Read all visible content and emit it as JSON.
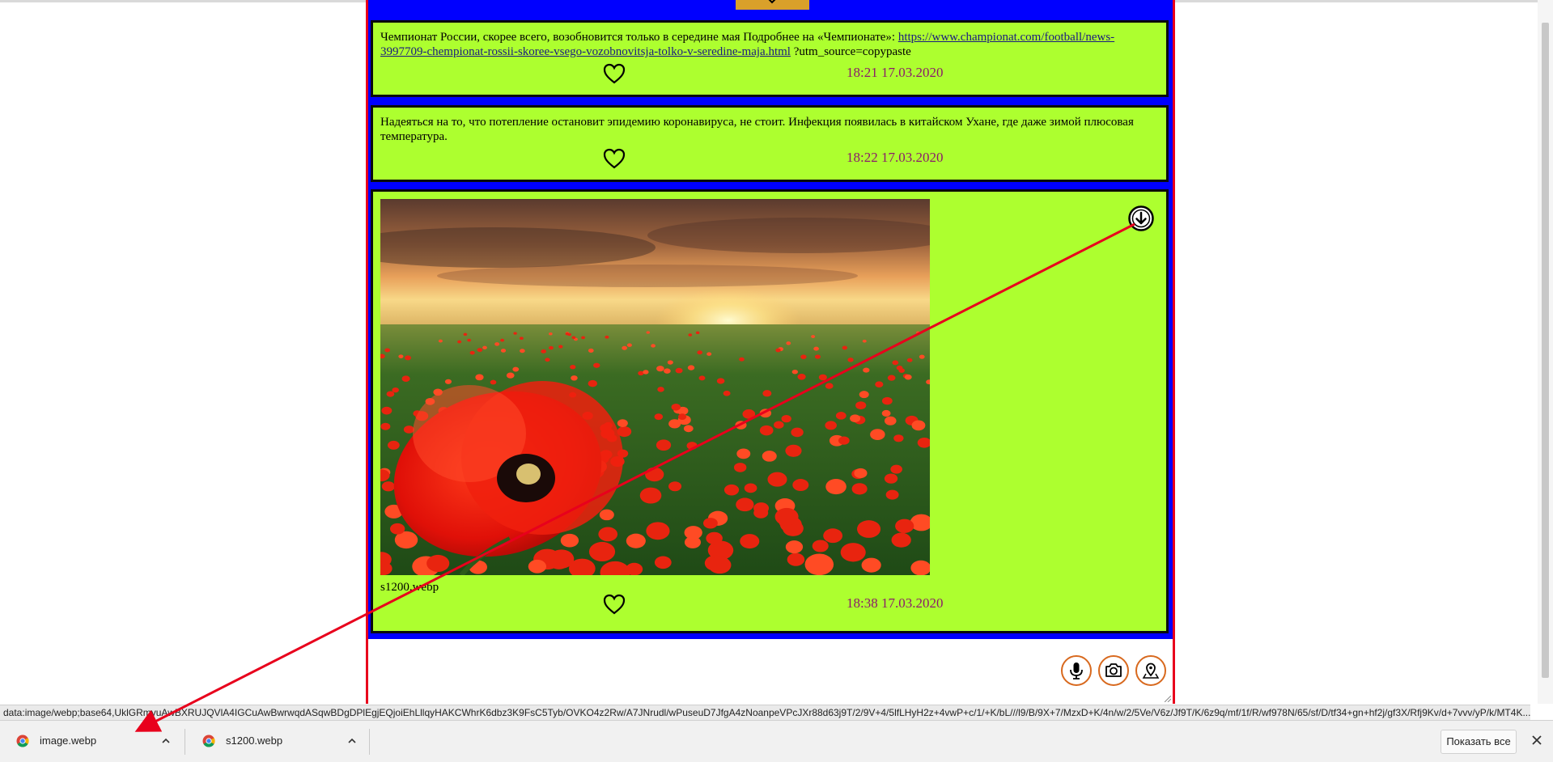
{
  "messages": [
    {
      "text_before": "Чемпионат России, скорее всего, возобновится только в середине мая Подробнее на «Чемпионате»: ",
      "link": "https://www.championat.com/football/news-3997709-chempionat-rossii-skoree-vsego-vozobnovitsja-tolko-v-seredine-maja.html",
      "text_after": " ?utm_source=copypaste",
      "time": "18:21 17.03.2020"
    },
    {
      "text": "Надеяться на то, что потепление остановит эпидемию коронавируса, не стоит. Инфекция появилась в китайском Ухане, где даже зимой плюсовая температура.",
      "time": "18:22 17.03.2020"
    },
    {
      "file_name": "s1200.webp",
      "time": "18:38 17.03.2020"
    }
  ],
  "icons": {
    "like": "heart-icon",
    "download": "download-arrow-icon",
    "mic": "microphone-icon",
    "camera": "camera-icon",
    "geo": "location-pin-icon"
  },
  "colors": {
    "message_bg": "#adff2f",
    "feed_bg": "#0000ff",
    "border": "#e8001c",
    "time": "#8b1c6a",
    "button_ring": "#d8691e"
  },
  "status_url": "data:image/webp;base64,UklGRmyuAwBXRUJQVlA4IGCuAwBwrwqdASqwBDgDPlEgjEQjoiEhLllqyHAKCWhrK6dbz3K9FsC5Tyb/OVKO4z2Rw/A7JNrudl/wPuseuD7JfgA4zNoanpeVPcJXr88d63j9T/2/9V+4/5lfLHyH2z+4vwP+c/1/+K/bL///l9/B/9X+7/MzxD+K/4n/w/2/5Ve/V6z/Jf9T/K/6z9q/mf/1f/R/wf978N/65/sf/D/tf34+gn+hf2j/gf3X/Rfj9Kv/d+7vvv/yP/k/MT4K...",
  "downloads": [
    {
      "name": "image.webp"
    },
    {
      "name": "s1200.webp"
    }
  ],
  "shelf": {
    "show_all": "Показать все"
  }
}
